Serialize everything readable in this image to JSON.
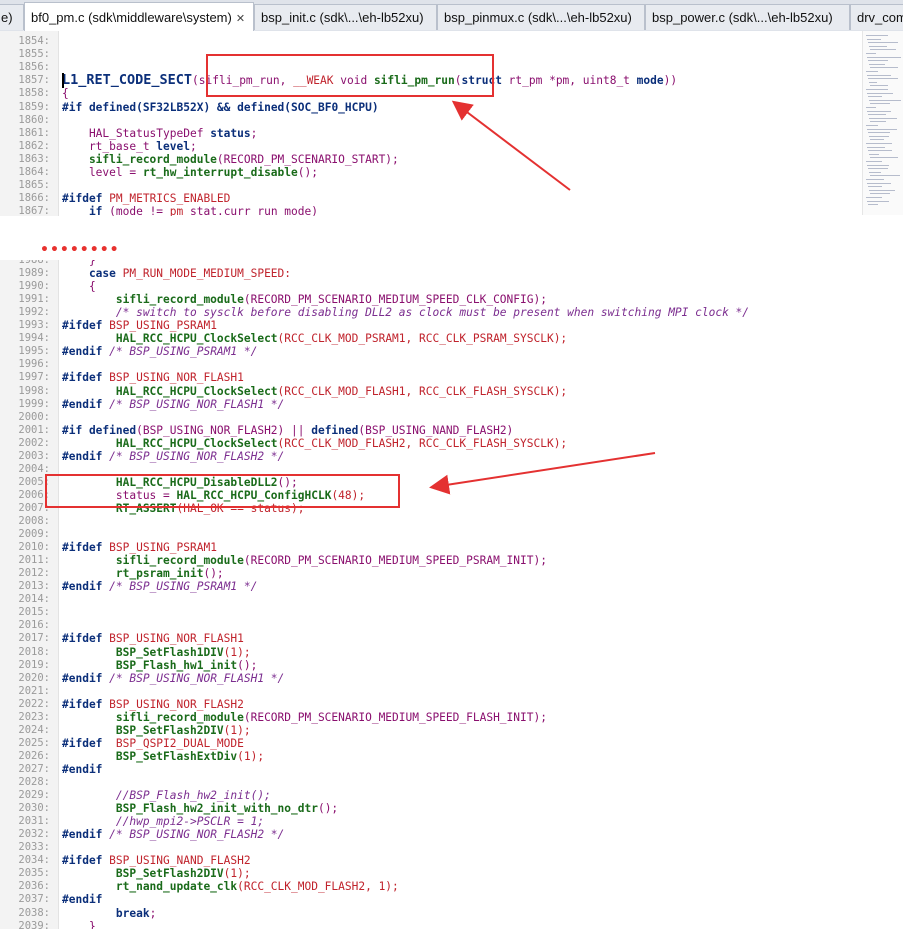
{
  "tabs": [
    {
      "label": "e)",
      "active": false
    },
    {
      "label": "bf0_pm.c (sdk\\middleware\\system)",
      "active": true,
      "close": "✕"
    },
    {
      "label": "bsp_init.c (sdk\\...\\eh-lb52xu)",
      "active": false
    },
    {
      "label": "bsp_pinmux.c (sdk\\...\\eh-lb52xu)",
      "active": false
    },
    {
      "label": "bsp_power.c (sdk\\...\\eh-lb52xu)",
      "active": false
    },
    {
      "label": "drv_com",
      "active": false
    }
  ],
  "colors": {
    "annotation": "#e43131",
    "keyword": "#0b2f7a",
    "function": "#1a6b1a",
    "macro": "#8a0f6e",
    "number": "#c0232c"
  },
  "top_pane": {
    "lines": [
      {
        "n": "1854:",
        "segs": []
      },
      {
        "n": "1855:",
        "segs": []
      },
      {
        "n": "1856:",
        "segs": []
      },
      {
        "n": "1857:",
        "segs": [
          [
            "L1_RET_CODE_SECT",
            "kw big"
          ],
          [
            "(sifli_pm_run, ",
            "id"
          ],
          [
            "__WEAK",
            "str"
          ],
          [
            " void ",
            "ty"
          ],
          [
            "sifli_pm_run",
            "fn"
          ],
          [
            "(",
            "id"
          ],
          [
            "struct",
            "kw"
          ],
          [
            " rt_pm *pm, uint8_t ",
            "id"
          ],
          [
            "mode",
            "kw"
          ],
          [
            "))",
            "id"
          ]
        ]
      },
      {
        "n": "1858:",
        "segs": [
          [
            "{",
            "id"
          ]
        ]
      },
      {
        "n": "1859:",
        "segs": [
          [
            "#if defined",
            "pp"
          ],
          [
            "(SF32LB52X) && ",
            "pp"
          ],
          [
            "defined",
            "pp"
          ],
          [
            "(SOC_BF0_HCPU)",
            "pp"
          ]
        ]
      },
      {
        "n": "1860:",
        "segs": []
      },
      {
        "n": "1861:",
        "segs": [
          [
            "    HAL_StatusTypeDef ",
            "ty"
          ],
          [
            "status",
            "kw"
          ],
          [
            ";",
            "id"
          ]
        ]
      },
      {
        "n": "1862:",
        "segs": [
          [
            "    rt_base_t ",
            "ty"
          ],
          [
            "level",
            "kw"
          ],
          [
            ";",
            "id"
          ]
        ]
      },
      {
        "n": "1863:",
        "segs": [
          [
            "    sifli_record_module",
            "fn"
          ],
          [
            "(RECORD_PM_SCENARIO_START);",
            "id"
          ]
        ]
      },
      {
        "n": "1864:",
        "segs": [
          [
            "    level = ",
            "id"
          ],
          [
            "rt_hw_interrupt_disable",
            "fn"
          ],
          [
            "();",
            "id"
          ]
        ]
      },
      {
        "n": "1865:",
        "segs": []
      },
      {
        "n": "1866:",
        "segs": [
          [
            "#ifdef ",
            "pp"
          ],
          [
            "PM_METRICS_ENABLED",
            "str"
          ]
        ]
      },
      {
        "n": "1867:",
        "segs": [
          [
            "    if ",
            "kw"
          ],
          [
            "(mode != ",
            "id"
          ],
          [
            "pm",
            "str"
          ],
          [
            " stat",
            "id"
          ],
          [
            ".curr run mode)",
            "id"
          ]
        ]
      }
    ]
  },
  "separator_dots": "••••••••",
  "bottom_pane": {
    "lines": [
      {
        "n": "1988:",
        "segs": [
          [
            "    }",
            "id"
          ]
        ]
      },
      {
        "n": "1989:",
        "segs": [
          [
            "    case ",
            "kw"
          ],
          [
            "PM_RUN_MODE_MEDIUM_SPEED:",
            "str"
          ]
        ]
      },
      {
        "n": "1990:",
        "segs": [
          [
            "    {",
            "id"
          ]
        ]
      },
      {
        "n": "1991:",
        "segs": [
          [
            "        sifli_record_module",
            "fn"
          ],
          [
            "(RECORD_PM_SCENARIO_MEDIUM_SPEED_CLK_CONFIG);",
            "id"
          ]
        ]
      },
      {
        "n": "1992:",
        "segs": [
          [
            "        /* switch to sysclk before disabling DLL2 as clock must be present when switching MPI clock */",
            "cm"
          ]
        ]
      },
      {
        "n": "1993:",
        "segs": [
          [
            "#ifdef ",
            "pp"
          ],
          [
            "BSP_USING_PSRAM1",
            "str"
          ]
        ]
      },
      {
        "n": "1994:",
        "segs": [
          [
            "        HAL_RCC_HCPU_ClockSelect",
            "fn"
          ],
          [
            "(RCC_CLK_MOD_PSRAM1, RCC_CLK_PSRAM_SYSCLK);",
            "str"
          ]
        ]
      },
      {
        "n": "1995:",
        "segs": [
          [
            "#endif ",
            "pp"
          ],
          [
            "/* BSP_USING_PSRAM1 */",
            "cm"
          ]
        ]
      },
      {
        "n": "1996:",
        "segs": []
      },
      {
        "n": "1997:",
        "segs": [
          [
            "#ifdef ",
            "pp"
          ],
          [
            "BSP_USING_NOR_FLASH1",
            "str"
          ]
        ]
      },
      {
        "n": "1998:",
        "segs": [
          [
            "        HAL_RCC_HCPU_ClockSelect",
            "fn"
          ],
          [
            "(RCC_CLK_MOD_FLASH1, RCC_CLK_FLASH_SYSCLK);",
            "str"
          ]
        ]
      },
      {
        "n": "1999:",
        "segs": [
          [
            "#endif ",
            "pp"
          ],
          [
            "/* BSP_USING_NOR_FLASH1 */",
            "cm"
          ]
        ]
      },
      {
        "n": "2000:",
        "segs": []
      },
      {
        "n": "2001:",
        "segs": [
          [
            "#if defined",
            "pp"
          ],
          [
            "(BSP_USING_NOR_FLASH2) || ",
            "id"
          ],
          [
            "defined",
            "pp"
          ],
          [
            "(BSP_USING_NAND_FLASH2)",
            "id"
          ]
        ]
      },
      {
        "n": "2002:",
        "segs": [
          [
            "        HAL_RCC_HCPU_ClockSelect",
            "fn"
          ],
          [
            "(RCC_CLK_MOD_FLASH2, RCC_CLK_FLASH_SYSCLK);",
            "str"
          ]
        ]
      },
      {
        "n": "2003:",
        "segs": [
          [
            "#endif ",
            "pp"
          ],
          [
            "/* BSP_USING_NOR_FLASH2 */",
            "cm"
          ]
        ]
      },
      {
        "n": "2004:",
        "segs": []
      },
      {
        "n": "2005:",
        "segs": [
          [
            "        HAL_RCC_HCPU_DisableDLL2",
            "fn"
          ],
          [
            "();",
            "id"
          ]
        ]
      },
      {
        "n": "2006:",
        "segs": [
          [
            "        status = ",
            "id"
          ],
          [
            "HAL_RCC_HCPU_ConfigHCLK",
            "fn"
          ],
          [
            "(48);",
            "str"
          ]
        ]
      },
      {
        "n": "2007:",
        "segs": [
          [
            "        RT_ASSERT",
            "fn"
          ],
          [
            "(HAL_OK == status);",
            "str"
          ]
        ]
      },
      {
        "n": "2008:",
        "segs": []
      },
      {
        "n": "2009:",
        "segs": []
      },
      {
        "n": "2010:",
        "segs": [
          [
            "#ifdef ",
            "pp"
          ],
          [
            "BSP_USING_PSRAM1",
            "str"
          ]
        ]
      },
      {
        "n": "2011:",
        "segs": [
          [
            "        sifli_record_module",
            "fn"
          ],
          [
            "(RECORD_PM_SCENARIO_MEDIUM_SPEED_PSRAM_INIT);",
            "id"
          ]
        ]
      },
      {
        "n": "2012:",
        "segs": [
          [
            "        rt_psram_init",
            "fn"
          ],
          [
            "();",
            "id"
          ]
        ]
      },
      {
        "n": "2013:",
        "segs": [
          [
            "#endif ",
            "pp"
          ],
          [
            "/* BSP_USING_PSRAM1 */",
            "cm"
          ]
        ]
      },
      {
        "n": "2014:",
        "segs": []
      },
      {
        "n": "2015:",
        "segs": []
      },
      {
        "n": "2016:",
        "segs": []
      },
      {
        "n": "2017:",
        "segs": [
          [
            "#ifdef ",
            "pp"
          ],
          [
            "BSP_USING_NOR_FLASH1",
            "str"
          ]
        ]
      },
      {
        "n": "2018:",
        "segs": [
          [
            "        BSP_SetFlash1DIV",
            "fn"
          ],
          [
            "(1);",
            "str"
          ]
        ]
      },
      {
        "n": "2019:",
        "segs": [
          [
            "        BSP_Flash_hw1_init",
            "fn"
          ],
          [
            "();",
            "id"
          ]
        ]
      },
      {
        "n": "2020:",
        "segs": [
          [
            "#endif ",
            "pp"
          ],
          [
            "/* BSP_USING_NOR_FLASH1 */",
            "cm"
          ]
        ]
      },
      {
        "n": "2021:",
        "segs": []
      },
      {
        "n": "2022:",
        "segs": [
          [
            "#ifdef ",
            "pp"
          ],
          [
            "BSP_USING_NOR_FLASH2",
            "str"
          ]
        ]
      },
      {
        "n": "2023:",
        "segs": [
          [
            "        sifli_record_module",
            "fn"
          ],
          [
            "(RECORD_PM_SCENARIO_MEDIUM_SPEED_FLASH_INIT);",
            "id"
          ]
        ]
      },
      {
        "n": "2024:",
        "segs": [
          [
            "        BSP_SetFlash2DIV",
            "fn"
          ],
          [
            "(1);",
            "str"
          ]
        ]
      },
      {
        "n": "2025:",
        "segs": [
          [
            "#ifdef  ",
            "pp"
          ],
          [
            "BSP_QSPI2_DUAL_MODE",
            "str"
          ]
        ]
      },
      {
        "n": "2026:",
        "segs": [
          [
            "        BSP_SetFlashExtDiv",
            "fn"
          ],
          [
            "(1);",
            "str"
          ]
        ]
      },
      {
        "n": "2027:",
        "segs": [
          [
            "#endif",
            "pp"
          ]
        ]
      },
      {
        "n": "2028:",
        "segs": []
      },
      {
        "n": "2029:",
        "segs": [
          [
            "        //BSP_Flash_hw2_init();",
            "cm"
          ]
        ]
      },
      {
        "n": "2030:",
        "segs": [
          [
            "        BSP_Flash_hw2_init_with_no_dtr",
            "fn"
          ],
          [
            "();",
            "id"
          ]
        ]
      },
      {
        "n": "2031:",
        "segs": [
          [
            "        //hwp_mpi2->PSCLR = 1;",
            "cm"
          ]
        ]
      },
      {
        "n": "2032:",
        "segs": [
          [
            "#endif ",
            "pp"
          ],
          [
            "/* BSP_USING_NOR_FLASH2 */",
            "cm"
          ]
        ]
      },
      {
        "n": "2033:",
        "segs": []
      },
      {
        "n": "2034:",
        "segs": [
          [
            "#ifdef ",
            "pp"
          ],
          [
            "BSP_USING_NAND_FLASH2",
            "str"
          ]
        ]
      },
      {
        "n": "2035:",
        "segs": [
          [
            "        BSP_SetFlash2DIV",
            "fn"
          ],
          [
            "(1);",
            "str"
          ]
        ]
      },
      {
        "n": "2036:",
        "segs": [
          [
            "        rt_nand_update_clk",
            "fn"
          ],
          [
            "(RCC_CLK_MOD_FLASH2, 1);",
            "str"
          ]
        ]
      },
      {
        "n": "2037:",
        "segs": [
          [
            "#endif",
            "pp"
          ]
        ]
      },
      {
        "n": "2038:",
        "segs": [
          [
            "        break",
            "kw"
          ],
          [
            ";",
            "id"
          ]
        ]
      },
      {
        "n": "2039:",
        "segs": [
          [
            "    }",
            "id"
          ]
        ]
      }
    ]
  }
}
